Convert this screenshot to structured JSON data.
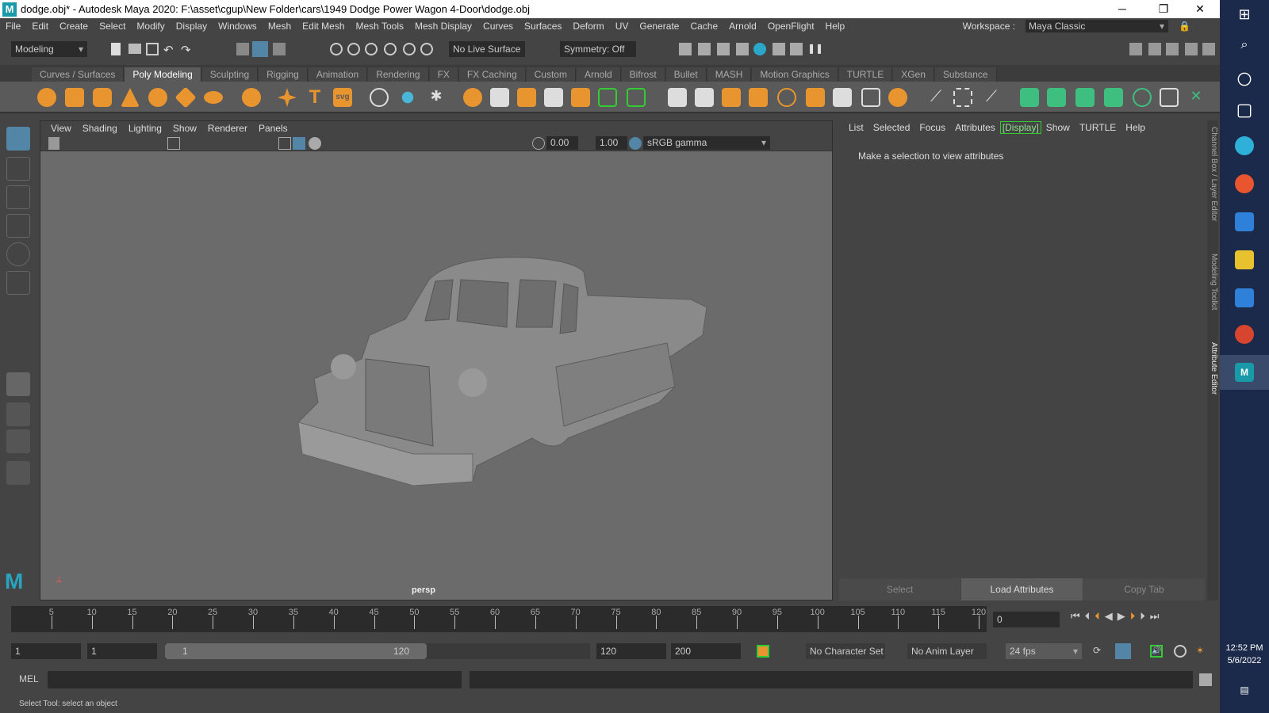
{
  "window": {
    "title": "dodge.obj* - Autodesk Maya 2020: F:\\asset\\cgup\\New Folder\\cars\\1949 Dodge Power Wagon 4-Door\\dodge.obj",
    "logo": "M",
    "minimize": "─",
    "restore": "❐",
    "close": "✕"
  },
  "menu": [
    "File",
    "Edit",
    "Create",
    "Select",
    "Modify",
    "Display",
    "Windows",
    "Mesh",
    "Edit Mesh",
    "Mesh Tools",
    "Mesh Display",
    "Curves",
    "Surfaces",
    "Deform",
    "UV",
    "Generate",
    "Cache",
    "Arnold",
    "OpenFlight",
    "Help"
  ],
  "workspace": {
    "label": "Workspace :",
    "value": "Maya Classic"
  },
  "status": {
    "mode": "Modeling",
    "live_surface": "No Live Surface",
    "symmetry": "Symmetry: Off"
  },
  "shelf_tabs": [
    "Curves / Surfaces",
    "Poly Modeling",
    "Sculpting",
    "Rigging",
    "Animation",
    "Rendering",
    "FX",
    "FX Caching",
    "Custom",
    "Arnold",
    "Bifrost",
    "Bullet",
    "MASH",
    "Motion Graphics",
    "TURTLE",
    "XGen",
    "Substance"
  ],
  "active_shelf": "Poly Modeling",
  "viewport": {
    "menu": [
      "View",
      "Shading",
      "Lighting",
      "Show",
      "Renderer",
      "Panels"
    ],
    "exposure": "0.00",
    "gamma": "1.00",
    "colorspace": "sRGB gamma",
    "camera": "persp"
  },
  "attribute_editor": {
    "menu": [
      "List",
      "Selected",
      "Focus",
      "Attributes",
      "Show",
      "TURTLE",
      "Help"
    ],
    "display_tab": "[Display]",
    "message": "Make a selection to view attributes",
    "buttons": [
      "Select",
      "Load Attributes",
      "Copy Tab"
    ]
  },
  "side_tabs": [
    "Channel Box / Layer Editor",
    "Modeling Toolkit",
    "Attribute Editor"
  ],
  "timeline": {
    "ticks": [
      5,
      10,
      15,
      20,
      25,
      30,
      35,
      40,
      45,
      50,
      55,
      60,
      65,
      70,
      75,
      80,
      85,
      90,
      95,
      100,
      105,
      110,
      115,
      120
    ],
    "current": "0"
  },
  "range": {
    "start": "1",
    "playback_start": "1",
    "slider_start": "1",
    "slider_end": "120",
    "playback_end": "120",
    "end": "200",
    "character_set": "No Character Set",
    "anim_layer": "No Anim Layer",
    "fps": "24 fps"
  },
  "mel": {
    "label": "MEL"
  },
  "help_line": "Select Tool: select an object",
  "taskbar": {
    "time": "12:52 PM",
    "date": "5/6/2022"
  },
  "colors": {
    "accent": "#5285a6",
    "highlight": "#3c3",
    "shelf_orange": "#e8952f"
  }
}
